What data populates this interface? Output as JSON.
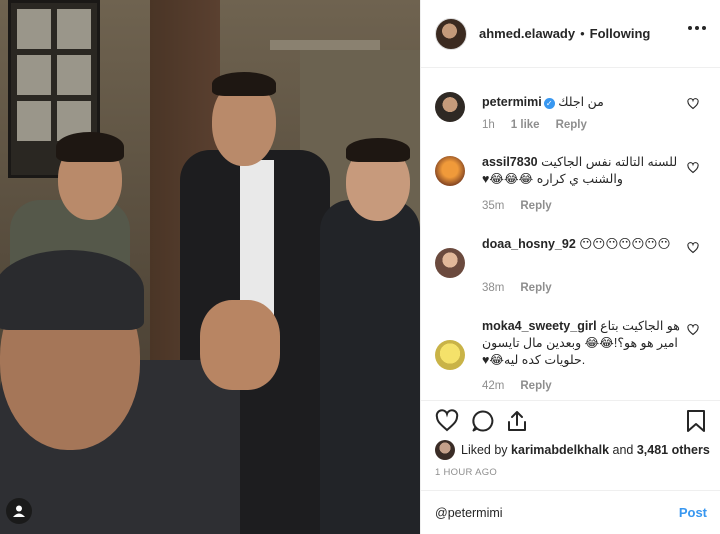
{
  "header": {
    "username": "ahmed.elawady",
    "separator": "•",
    "follow_status": "Following"
  },
  "comments": [
    {
      "username": "petermimi",
      "verified": true,
      "text": "من اجلك",
      "time": "1h",
      "likes": "1 like",
      "reply": "Reply"
    },
    {
      "username": "assil7830",
      "text": "للسنه التالته نفس الجاكيت والشنب ي كراره 😂😂😂♥",
      "time": "35m",
      "reply": "Reply"
    },
    {
      "username": "doaa_hosny_92",
      "text": "😶😶😶😶😶😶😶",
      "time": "38m",
      "reply": "Reply"
    },
    {
      "username": "moka4_sweety_girl",
      "text": "هو الجاكيت بتاع امير هو هو؟!😂😂 وبعدين مال تايسون .حلويات كده ليه😂♥",
      "time": "42m",
      "reply": "Reply"
    }
  ],
  "likes": {
    "prefix": "Liked by",
    "user": "karimabdelkhalk",
    "and": "and",
    "others": "3,481 others"
  },
  "timestamp": "1 HOUR AGO",
  "add_comment": {
    "text": "@petermimi",
    "post_label": "Post"
  },
  "colors": {
    "link": "#3897f0",
    "muted": "#8e8e8e",
    "text": "#262626",
    "border": "#efefef"
  },
  "icons": [
    "heart-icon",
    "comment-icon",
    "share-icon",
    "bookmark-icon",
    "more-icon",
    "verified-icon",
    "user-tag-icon"
  ]
}
